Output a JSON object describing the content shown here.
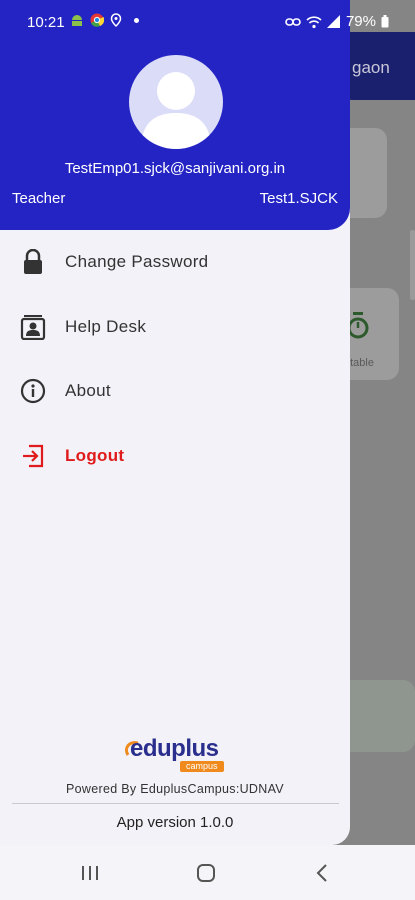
{
  "status_bar": {
    "time": "10:21",
    "battery": "79%"
  },
  "background": {
    "header_partial": "gaon",
    "card_partial": "etable"
  },
  "drawer": {
    "email": "TestEmp01.sjck@sanjivani.org.in",
    "role": "Teacher",
    "code": "Test1.SJCK",
    "menu": [
      {
        "label": "Change Password",
        "icon": "lock-icon"
      },
      {
        "label": "Help Desk",
        "icon": "helpdesk-icon"
      },
      {
        "label": "About",
        "icon": "info-icon"
      },
      {
        "label": "Logout",
        "icon": "logout-icon"
      }
    ],
    "logo": {
      "main": "eduplus",
      "sub": "campus"
    },
    "powered_by": "Powered By EduplusCampus:UDNAV",
    "version": "App version 1.0.0"
  },
  "colors": {
    "primary": "#2424c4",
    "logout": "#e01b1b",
    "logo_orange": "#f08a1c",
    "logo_navy": "#2a2e8c"
  }
}
